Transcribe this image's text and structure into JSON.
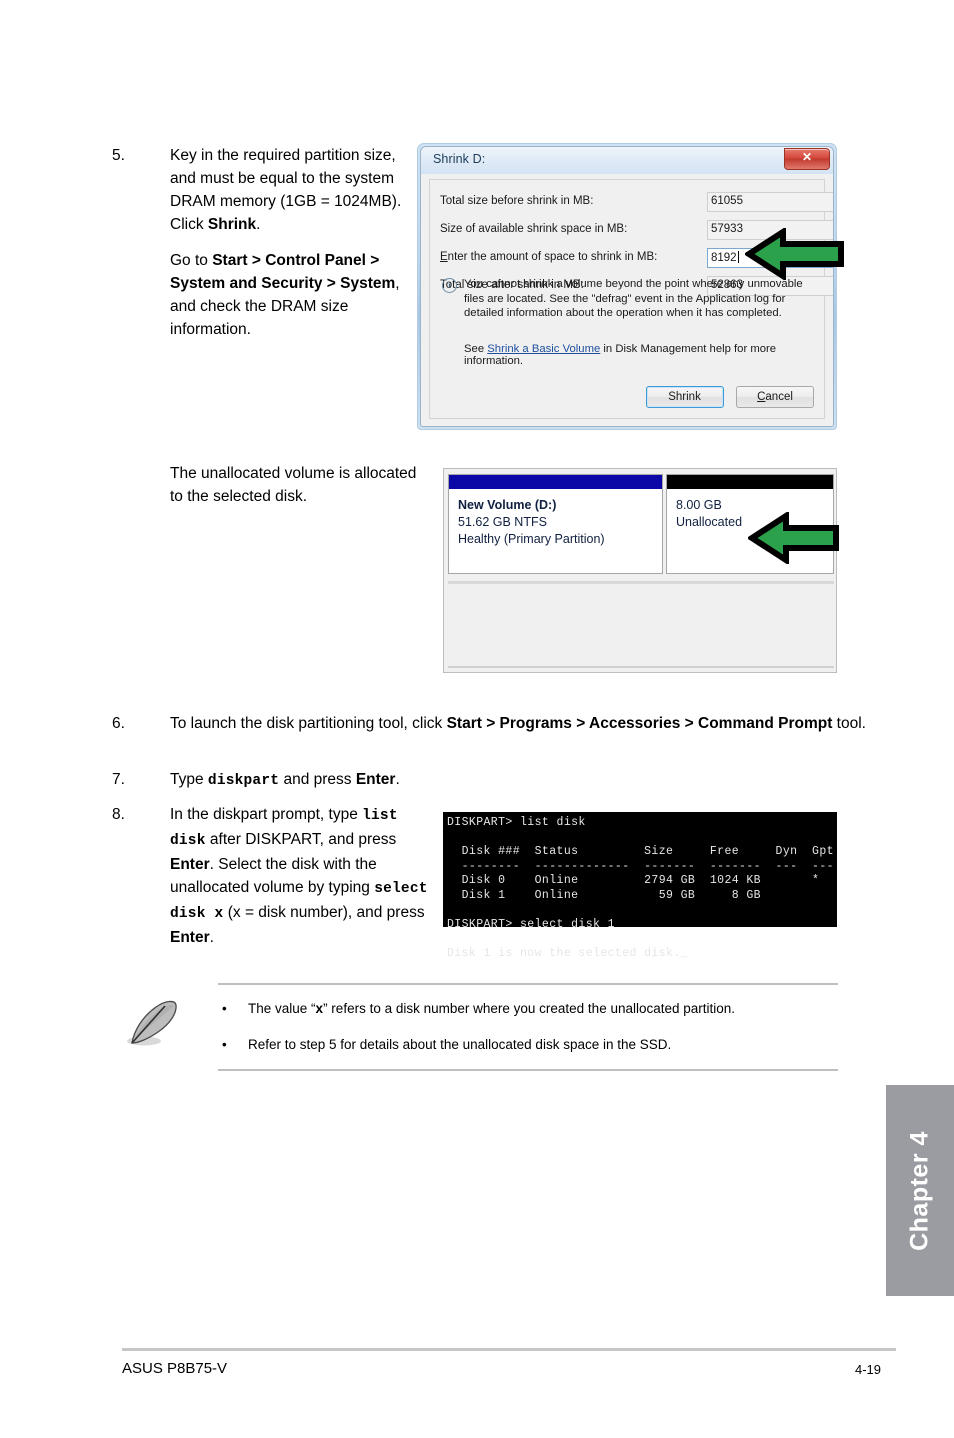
{
  "steps": [
    {
      "number": "5.",
      "paragraph1_a": "Key in the required partition size, and must be equal to the system DRAM memory (1GB = 1024MB). Click ",
      "paragraph1_bold": "Shrink",
      "paragraph1_b": ".",
      "paragraph2_a": "Go to ",
      "paragraph2_bold1": "Start > Control Panel > System and Security > System",
      "paragraph2_b": ", and check the DRAM size information."
    },
    {
      "number": "6.",
      "text_a": "To launch the disk partitioning tool, click ",
      "bold1": "Start > Programs > Accessories > Command Prompt",
      "text_b": " tool."
    },
    {
      "number": "7.",
      "text_a": "Type ",
      "mono1": "diskpart",
      "text_b": " and press ",
      "bold1": "Enter",
      "text_c": "."
    },
    {
      "number": "8.",
      "text_a": "In the diskpart prompt, type ",
      "mono1": "list disk",
      "text_b": " after DISKPART, and press ",
      "bold1": "Enter",
      "text_c": ". Select the disk with the unallocated volume by typing ",
      "mono2": "select disk x",
      "text_d": " (x = disk number), and press ",
      "bold2": "Enter",
      "text_e": "."
    }
  ],
  "caption": {
    "unallocated_note": "The unallocated volume is allocated to the selected disk."
  },
  "dialog": {
    "title": "Shrink D:",
    "close_glyph": "✕",
    "close_icon_name": "close-icon",
    "fields": [
      {
        "label": "Total size before shrink in MB:",
        "value": "61055",
        "editable": false
      },
      {
        "label": "Size of available shrink space in MB:",
        "value": "57933",
        "editable": false
      },
      {
        "label_underline": "E",
        "label_rest": "nter the amount of space to shrink in MB:",
        "value": "8192",
        "editable": true
      },
      {
        "label": "Total size after shrink in MB:",
        "value": "52863",
        "editable": false
      }
    ],
    "info_icon_glyph": "i",
    "info_text": "You cannot shrink a volume beyond the point where any unmovable files are located. See the \"defrag\" event in the Application log for detailed information about the operation when it has completed.",
    "help_prefix": "See ",
    "help_link": "Shrink a Basic Volume",
    "help_suffix": " in Disk Management help for more information.",
    "button_shrink": "Shrink",
    "button_cancel_underline": "C",
    "button_cancel_rest": "ancel"
  },
  "disk_management": {
    "volume_primary": {
      "cap_color": "#0c08a8",
      "line1": "New Volume  (D:)",
      "line2": "51.62 GB NTFS",
      "line3": "Healthy (Primary Partition)"
    },
    "volume_unallocated": {
      "cap_color": "#000000",
      "line1": "8.00 GB",
      "line2": "Unallocated"
    }
  },
  "terminal": {
    "content": "DISKPART> list disk\n\n  Disk ###  Status         Size     Free     Dyn  Gpt\n  --------  -------------  -------  -------  ---  ---\n  Disk 0    Online         2794 GB  1024 KB       *\n  Disk 1    Online           59 GB     8 GB\n\nDISKPART> select disk 1\n\nDisk 1 is now the selected disk._"
  },
  "note": {
    "icon_name": "note-feather-icon",
    "bullet": "•",
    "items": [
      {
        "text_a": "The value “",
        "bold": "x",
        "text_b": "” refers to a disk number where you created the unallocated partition."
      },
      {
        "text_a": "Refer to step 5 for details about the unallocated disk space in the SSD.",
        "bold": "",
        "text_b": ""
      }
    ]
  },
  "chapter_tab": {
    "label": "Chapter 4",
    "color": "#9b9ca1"
  },
  "footer": {
    "left": "ASUS P8B75-V",
    "right": "4-19"
  }
}
